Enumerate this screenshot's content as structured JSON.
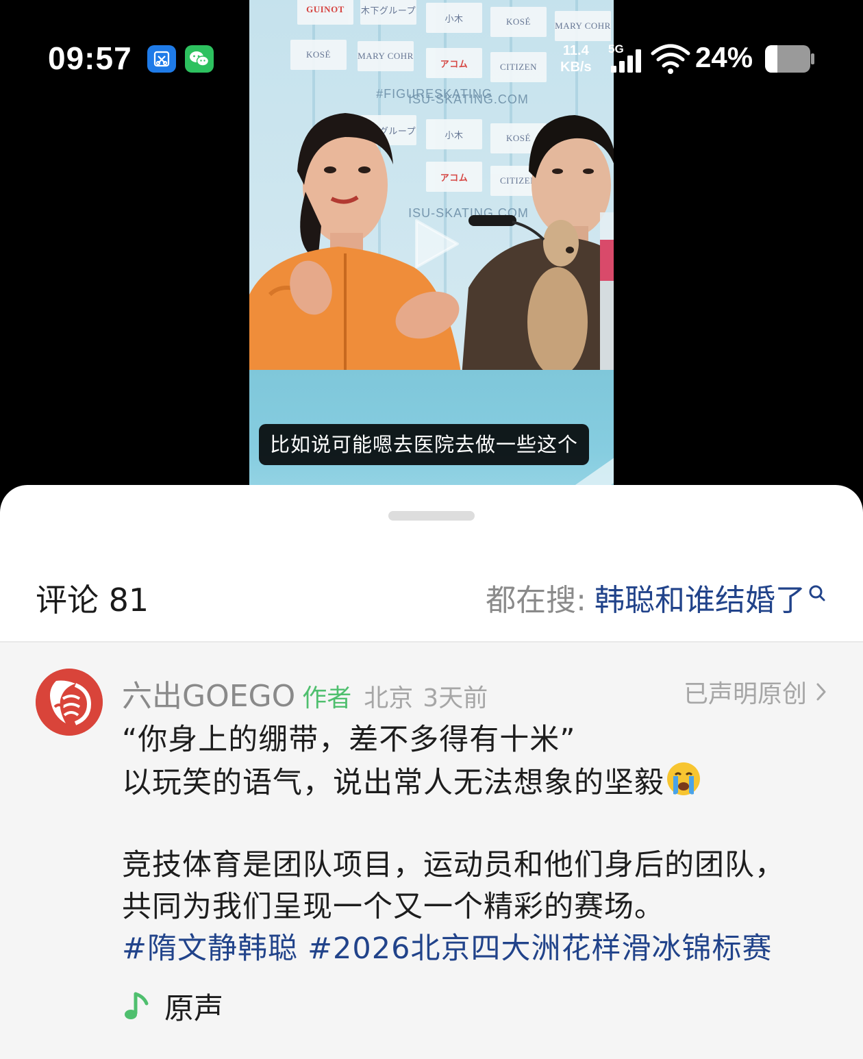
{
  "status_bar": {
    "time": "09:57",
    "net_speed_value": "11.4",
    "net_speed_unit": "KB/s",
    "network": "5G",
    "battery": "24%"
  },
  "video": {
    "caption": "比如说可能嗯去医院去做一些这个",
    "sponsors": [
      "GUINOT",
      "木下グループ",
      "小木",
      "KOSÉ",
      "MARY COHR",
      "CITIZEN",
      "アコム"
    ],
    "backdrop_text": "ISU-SKATING.COM",
    "hashtag_backdrop": "#FIGURESKATING"
  },
  "comments": {
    "title": "评论 81",
    "search_prefix": "都在搜:",
    "search_term": "韩聪和谁结婚了"
  },
  "pinned_comment": {
    "author": "六出GOEGO",
    "author_tag": "作者",
    "location": "北京",
    "time_ago": "3天前",
    "original_label": "已声明原创",
    "lines": [
      "“你身上的绷带，差不多得有十米”",
      "以玩笑的语气，说出常人无法想象的坚毅",
      "",
      "竞技体育是团队项目，运动员和他们身后的团队，",
      "共同为我们呈现一个又一个精彩的赛场。"
    ],
    "hashtags": [
      "#隋文静韩聪",
      "#2026北京四大洲花样滑冰锦标赛"
    ],
    "music_label": "原声"
  },
  "colors": {
    "link": "#21438a",
    "author_tag": "#4fbf6e",
    "avatar_bg": "#d9443a"
  }
}
